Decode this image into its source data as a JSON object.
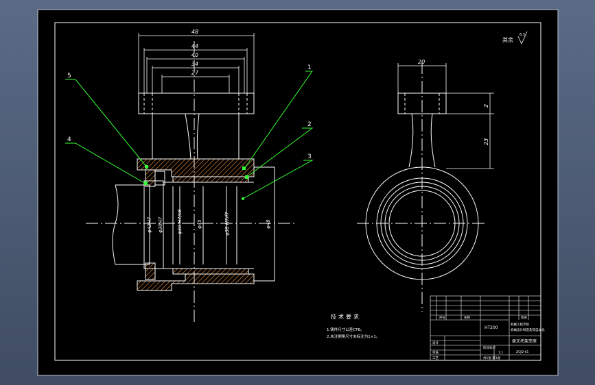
{
  "drawing": {
    "dims": {
      "d48": "48",
      "d44": "44",
      "d40": "40",
      "d34": "34",
      "d27": "27",
      "d20": "20",
      "d2": "2",
      "d23": "23",
      "dia1": "φ42H7",
      "dia2": "φ30H7",
      "dia3": "φ30 H7/e8",
      "dia4": "φ45",
      "dia5": "φ38 H7/f7",
      "dia6": "φ48"
    },
    "balloons": [
      "1",
      "2",
      "3",
      "4",
      "5"
    ],
    "roughness": {
      "label": "其余",
      "value": "6.3"
    },
    "tech_req": {
      "title": "技术要求",
      "line1": "1.铸件尺寸公差CT8。",
      "line2": "2.未注倒角尺寸未标注为1×1。"
    },
    "title_block": {
      "material": "HT200",
      "name": "拨叉托架支座",
      "code": "ZCJD-01",
      "school": "机械工程学院",
      "subtitle": "机械设计制造及其自动化",
      "scale_label": "比例",
      "sheet": "共1张 第1张",
      "row1": "序号",
      "row2": "名称",
      "row3": "代号",
      "row4": "数量",
      "label_a": "设计",
      "label_b": "审核",
      "label_c": "工艺",
      "label_d": "标准化",
      "label_e": "批准",
      "label_f": "日期",
      "label_g": "签名",
      "label_h": "更改文件号",
      "label_i": "标记",
      "label_j": "处数",
      "label_k": "分区",
      "label_l": "年月日",
      "label_m": "阶段标记",
      "label_n": "重量",
      "label_o": "比例值",
      "label_p": "图样标记",
      "label_q": "1:1"
    }
  },
  "colors": {
    "frame": "#ffffff",
    "paper": "#000000",
    "hatch": "#ff9a3a",
    "leader": "#33ff33",
    "dim": "#ffffff",
    "center": "#ffffff"
  }
}
